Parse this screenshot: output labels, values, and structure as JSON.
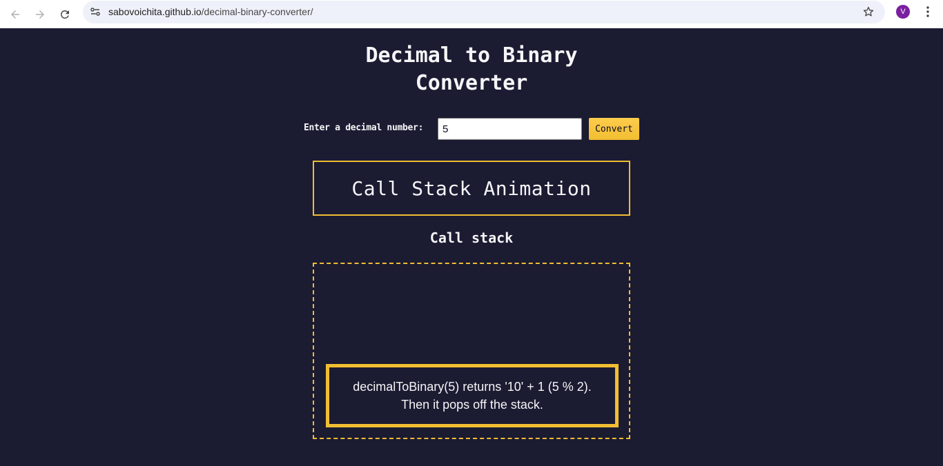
{
  "browser": {
    "url_host": "sabovoichita.github.io",
    "url_path": "/decimal-binary-converter/",
    "avatar_letter": "V"
  },
  "page": {
    "title_line1": "Decimal to Binary",
    "title_line2": "Converter",
    "input_label": "Enter a decimal number:",
    "input_value": "5",
    "convert_label": "Convert",
    "animation_title": "Call Stack Animation",
    "stack_heading": "Call stack",
    "stack_frame_line1": "decimalToBinary(5) returns '10' + 1 (5 % 2).",
    "stack_frame_line2": "Then it pops off the stack."
  },
  "colors": {
    "background": "#1b1b32",
    "accent": "#f1be32",
    "text": "#f5f6f7",
    "avatar": "#7b1fa2"
  },
  "icons": [
    "back-arrow-icon",
    "forward-arrow-icon",
    "reload-icon",
    "site-info-icon",
    "bookmark-star-icon",
    "more-menu-icon"
  ]
}
